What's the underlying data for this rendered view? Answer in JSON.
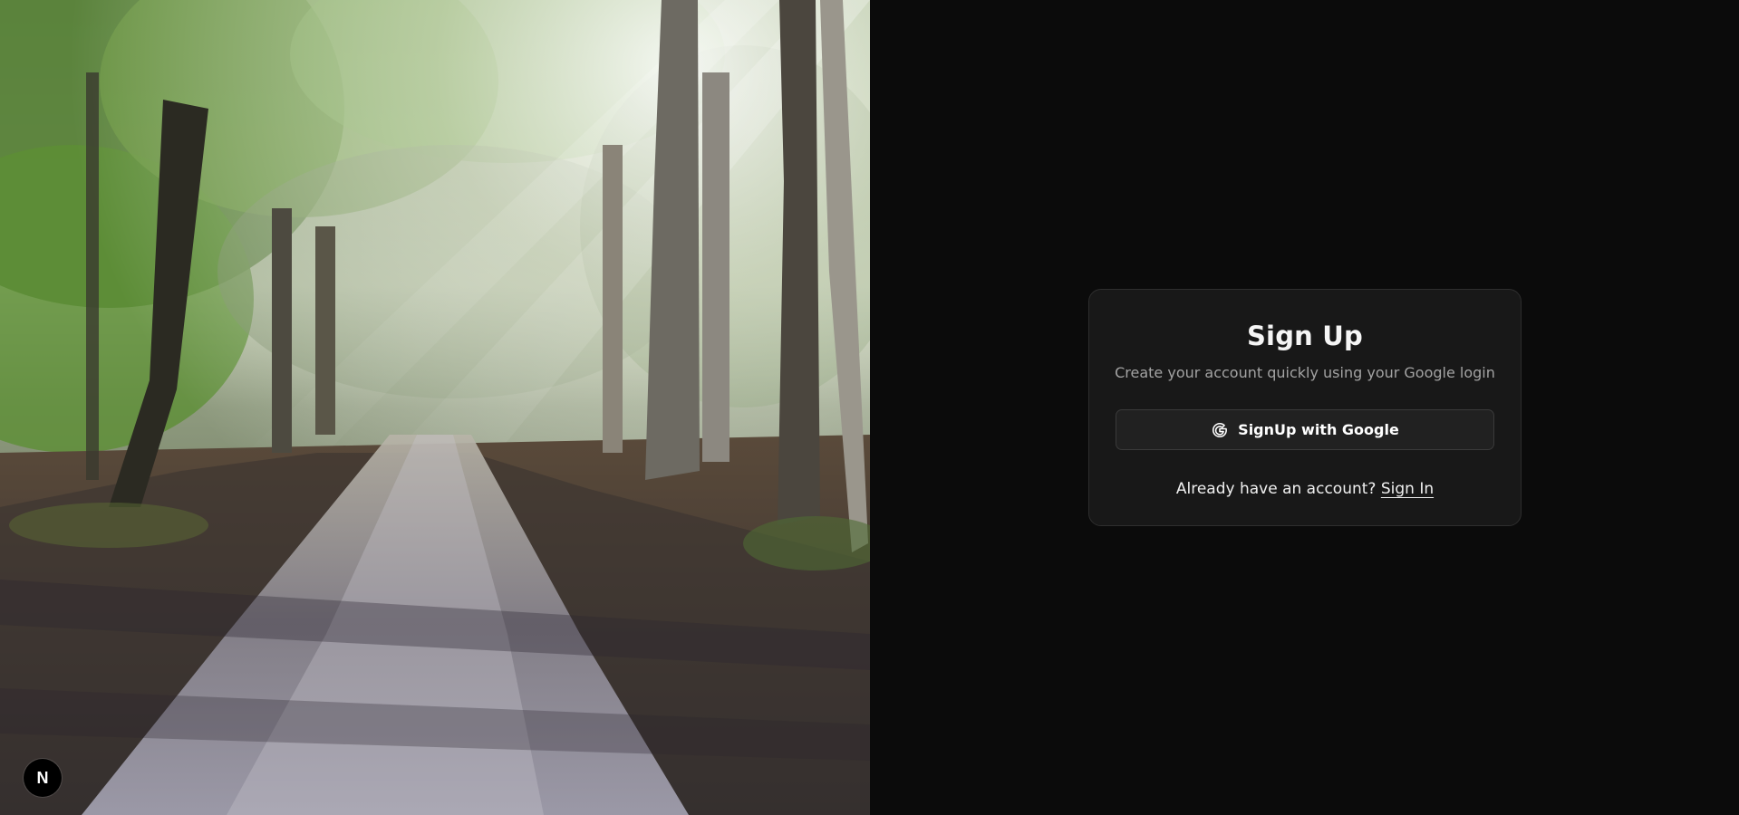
{
  "hero": {
    "image_subject": "sunlit forest path"
  },
  "dev_badge": {
    "letter": "N"
  },
  "auth": {
    "title": "Sign Up",
    "subtitle": "Create your account quickly using your Google login",
    "google_button_label": "SignUp with Google",
    "google_icon": "google-icon",
    "signin_prompt": "Already have an account?",
    "signin_link_label": "Sign In"
  },
  "colors": {
    "background": "#0b0b0b",
    "card_background": "#181818",
    "card_border": "#2e2e2e",
    "button_background": "#212121",
    "title_text": "#f5f5f5",
    "subtitle_text": "#a3a3a3"
  }
}
